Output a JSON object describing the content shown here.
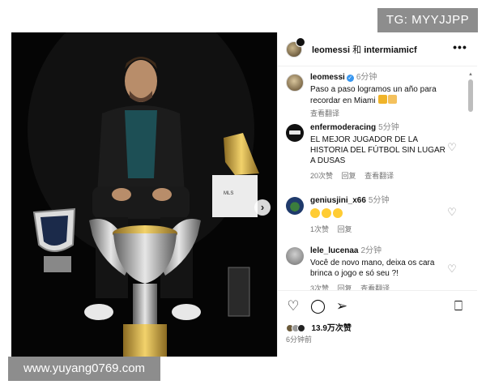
{
  "overlay": {
    "tg_badge": "TG: MYYJJPP",
    "url_badge": "www.yuyang0769.com"
  },
  "header": {
    "user1": "leomessi",
    "conjunction": "和",
    "user2": "intermiamicf",
    "more_icon": "more-horizontal-icon"
  },
  "caption": {
    "username": "leomessi",
    "verified": true,
    "time": "6分钟",
    "text": "Paso a paso logramos un año para recordar en Miami",
    "translate": "查看翻译"
  },
  "comments": [
    {
      "username": "enfermoderacing",
      "time": "5分钟",
      "text": "EL MEJOR JUGADOR DE LA HISTORIA DEL FÚTBOL SIN LUGAR A DUSAS",
      "likes": "20次赞",
      "reply": "回复",
      "translate": "查看翻译"
    },
    {
      "username": "geniusjini_x66",
      "time": "5分钟",
      "text": "",
      "likes": "1次赞",
      "reply": "回复"
    },
    {
      "username": "lele_lucenaa",
      "time": "2分钟",
      "text": "Você de novo mano, deixa os cara brinca o jogo e só seu ?!",
      "likes": "3次赞",
      "reply": "回复",
      "translate": "查看翻译"
    }
  ],
  "footer": {
    "likes": "13.9万次赞",
    "posted": "6分钟前"
  },
  "colors": {
    "verified": "#3897f0",
    "overlay_bg": "#8d8d8d",
    "photo_bg": "#050505"
  }
}
